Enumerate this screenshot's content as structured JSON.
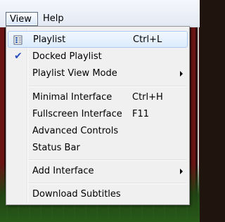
{
  "menubar": {
    "items": [
      {
        "label": "View",
        "active": true
      },
      {
        "label": "Help",
        "active": false
      }
    ]
  },
  "view_menu": {
    "groups": [
      [
        {
          "label": "Playlist",
          "shortcut": "Ctrl+L",
          "icon": "playlist-icon",
          "highlighted": true
        },
        {
          "label": "Docked Playlist",
          "shortcut": "",
          "checked": true
        },
        {
          "label": "Playlist View Mode",
          "shortcut": "",
          "submenu": true
        }
      ],
      [
        {
          "label": "Minimal Interface",
          "shortcut": "Ctrl+H"
        },
        {
          "label": "Fullscreen Interface",
          "shortcut": "F11"
        },
        {
          "label": "Advanced Controls",
          "shortcut": ""
        },
        {
          "label": "Status Bar",
          "shortcut": ""
        }
      ],
      [
        {
          "label": "Add Interface",
          "shortcut": "",
          "submenu": true
        }
      ],
      [
        {
          "label": "Download Subtitles",
          "shortcut": ""
        }
      ]
    ]
  },
  "colors": {
    "highlight_border": "#aeccf1",
    "check": "#2a4fbe"
  }
}
